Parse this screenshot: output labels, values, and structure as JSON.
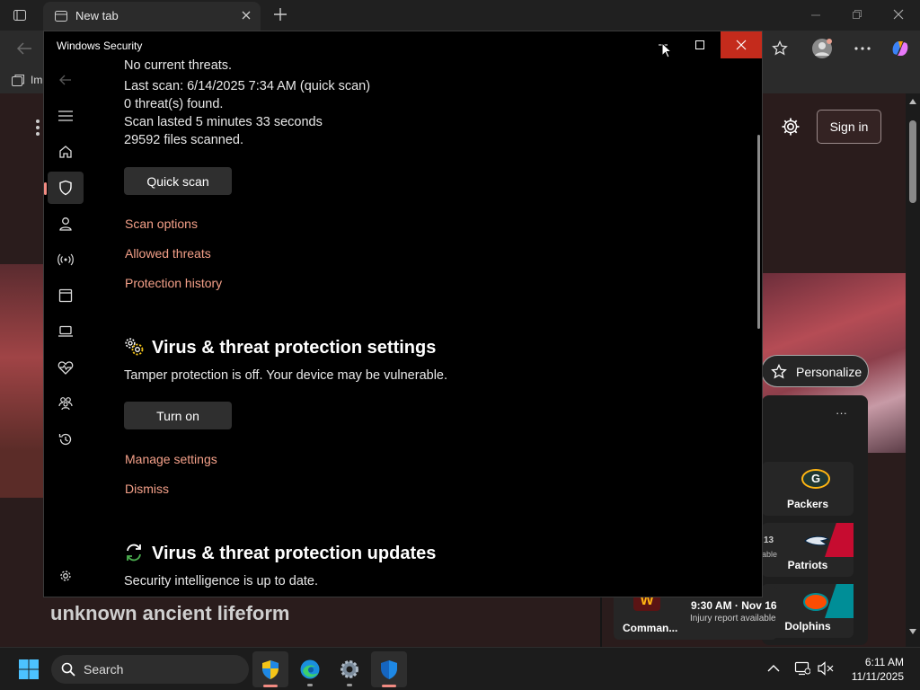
{
  "browser": {
    "tab_title": "New tab",
    "favorites_label": "Im",
    "sign_in": "Sign in",
    "personalize": "Personalize",
    "headline": "unknown ancient lifeform",
    "more": "···",
    "game_time": "9:30 AM · Nov 16",
    "game_note": "Injury report available",
    "partial_13": "13",
    "partial_able": "able",
    "partial_s": "s",
    "teams": [
      {
        "name": "Packers",
        "color": "#203731"
      },
      {
        "name": "Patriots",
        "color": "#c60c30"
      },
      {
        "name": "Dolphins",
        "color": "#008e97"
      },
      {
        "name": "Comman...",
        "color": "#5a1414"
      }
    ]
  },
  "security": {
    "window_title": "Windows Security",
    "status_lines": [
      "No current threats.",
      "Last scan: 6/14/2025 7:34 AM (quick scan)",
      "0 threat(s) found.",
      "Scan lasted 5 minutes 33 seconds",
      "29592 files scanned."
    ],
    "quick_scan": "Quick scan",
    "links1": [
      "Scan options",
      "Allowed threats",
      "Protection history"
    ],
    "settings_heading": "Virus & threat protection settings",
    "settings_text": "Tamper protection is off. Your device may be vulnerable.",
    "turn_on": "Turn on",
    "links2": [
      "Manage settings",
      "Dismiss"
    ],
    "updates_heading": "Virus & threat protection updates",
    "updates_text": "Security intelligence is up to date.",
    "close_color": "#c42b1c",
    "link_color": "#f4a089"
  },
  "taskbar": {
    "search_label": "Search",
    "time": "6:11 AM",
    "date": "11/11/2025"
  }
}
